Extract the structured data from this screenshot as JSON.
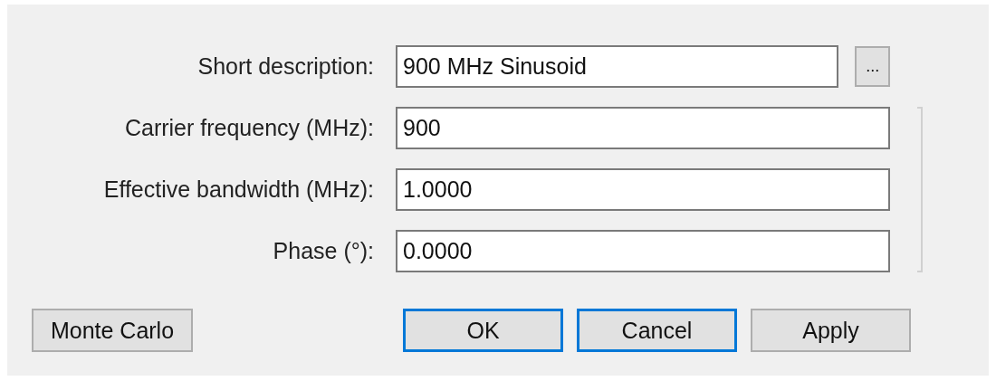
{
  "fields": [
    {
      "label": "Short description:",
      "value": "900 MHz Sinusoid",
      "browse": "..."
    },
    {
      "label": "Carrier frequency (MHz):",
      "value": "900"
    },
    {
      "label": "Effective bandwidth (MHz):",
      "value": "1.0000"
    },
    {
      "label": "Phase (°):",
      "value": "0.0000"
    }
  ],
  "buttons": [
    {
      "label": "Monte Carlo",
      "highlighted": false,
      "kind": "side"
    },
    {
      "label": "OK",
      "highlighted": true,
      "kind": "main"
    },
    {
      "label": "Cancel",
      "highlighted": true,
      "kind": "main"
    },
    {
      "label": "Apply",
      "highlighted": false,
      "kind": "main"
    }
  ]
}
